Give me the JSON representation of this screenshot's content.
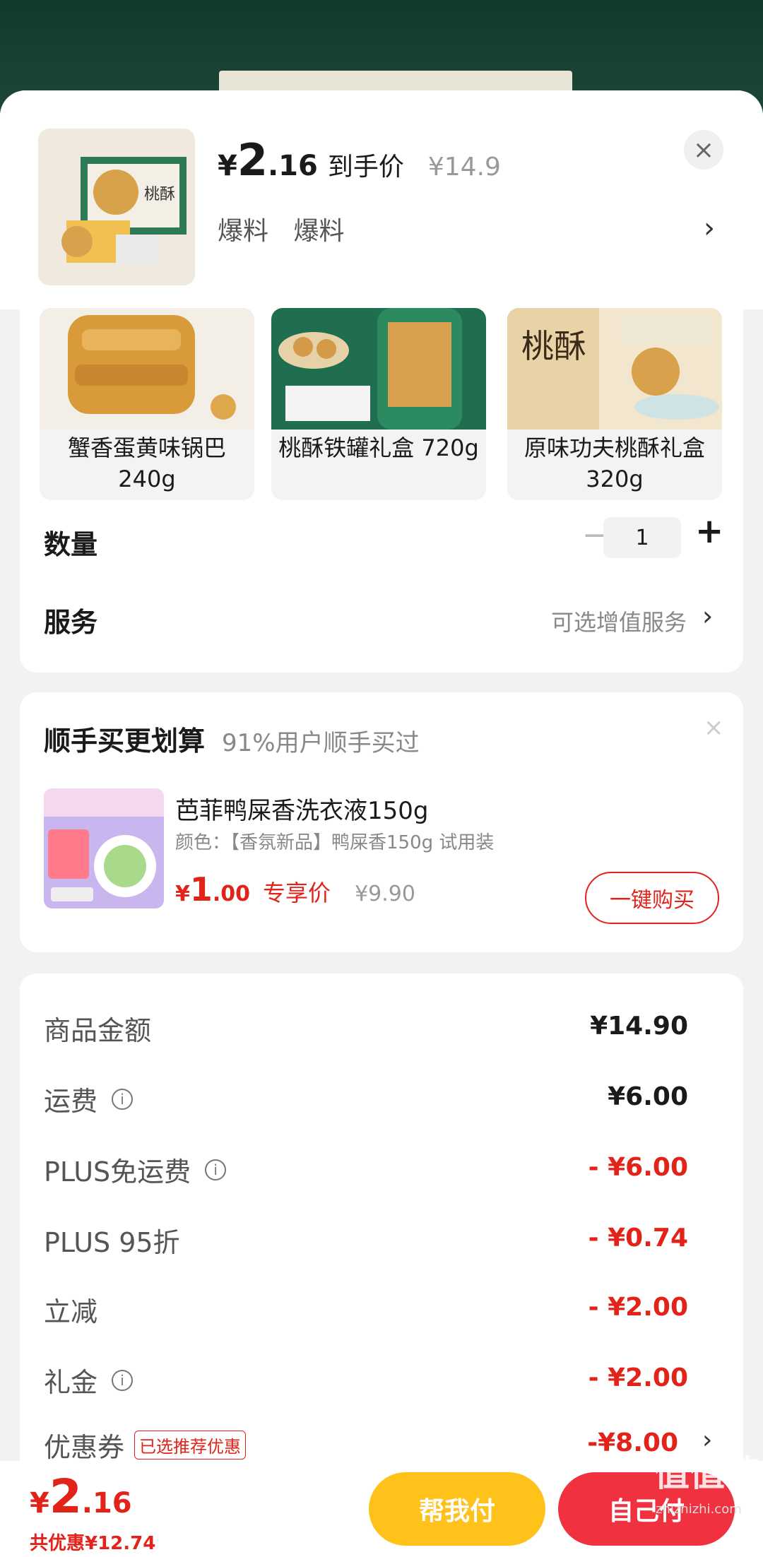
{
  "header": {
    "price_currency": "¥",
    "price_int": "2",
    "price_dec": ".16",
    "price_tag": "到手价",
    "orig_price": "¥14.9",
    "tags": [
      "爆料",
      "爆料"
    ],
    "close_symbol": "×",
    "chevron": "›"
  },
  "variants": [
    {
      "label": "蟹香蛋黄味锅巴 240g"
    },
    {
      "label": "桃酥铁罐礼盒 720g"
    },
    {
      "label": "原味功夫桃酥礼盒 320g"
    }
  ],
  "quantity": {
    "label": "数量",
    "minus": "−",
    "value": "1",
    "plus": "+"
  },
  "service": {
    "label": "服务",
    "value": "可选增值服务",
    "chevron": "›"
  },
  "bundle": {
    "title": "顺手买更划算",
    "subtitle": "91%用户顺手买过",
    "close_symbol": "×",
    "name": "芭菲鸭屎香洗衣液150g",
    "spec": "颜色：【香氛新品】鸭屎香150g 试用装",
    "price_currency": "¥",
    "price_int": "1",
    "price_dec": ".00",
    "price_tag": "专享价",
    "orig_price": "¥9.90",
    "buy_label": "一键购买"
  },
  "summary": {
    "rows": [
      {
        "label": "商品金额",
        "value": "¥14.90",
        "info": false,
        "red": false
      },
      {
        "label": "运费",
        "value": "¥6.00",
        "info": true,
        "red": false
      },
      {
        "label": "PLUS免运费",
        "value": "- ¥6.00",
        "info": true,
        "red": true
      },
      {
        "label": "PLUS 95折",
        "value": "- ¥0.74",
        "info": false,
        "red": true
      },
      {
        "label": "立减",
        "value": "- ¥2.00",
        "info": false,
        "red": true
      },
      {
        "label": "礼金",
        "value": "- ¥2.00",
        "info": true,
        "red": true
      }
    ],
    "coupon": {
      "label": "优惠券",
      "badge": "已选推荐优惠",
      "value": "-¥8.00",
      "chevron": "›"
    },
    "info_glyph": "i"
  },
  "bottom": {
    "total_currency": "¥",
    "total_int": "2",
    "total_dec": ".16",
    "saved": "共优惠¥12.74",
    "help_pay": "帮我付",
    "self_pay": "自己付"
  },
  "watermark": {
    "text": "值值值",
    "site": "zhizhizhi.com"
  },
  "colors": {
    "accent_red": "#e2231a",
    "help_button": "#ffc21a",
    "self_button": "#f0313f",
    "backdrop": "#1f3d32"
  }
}
